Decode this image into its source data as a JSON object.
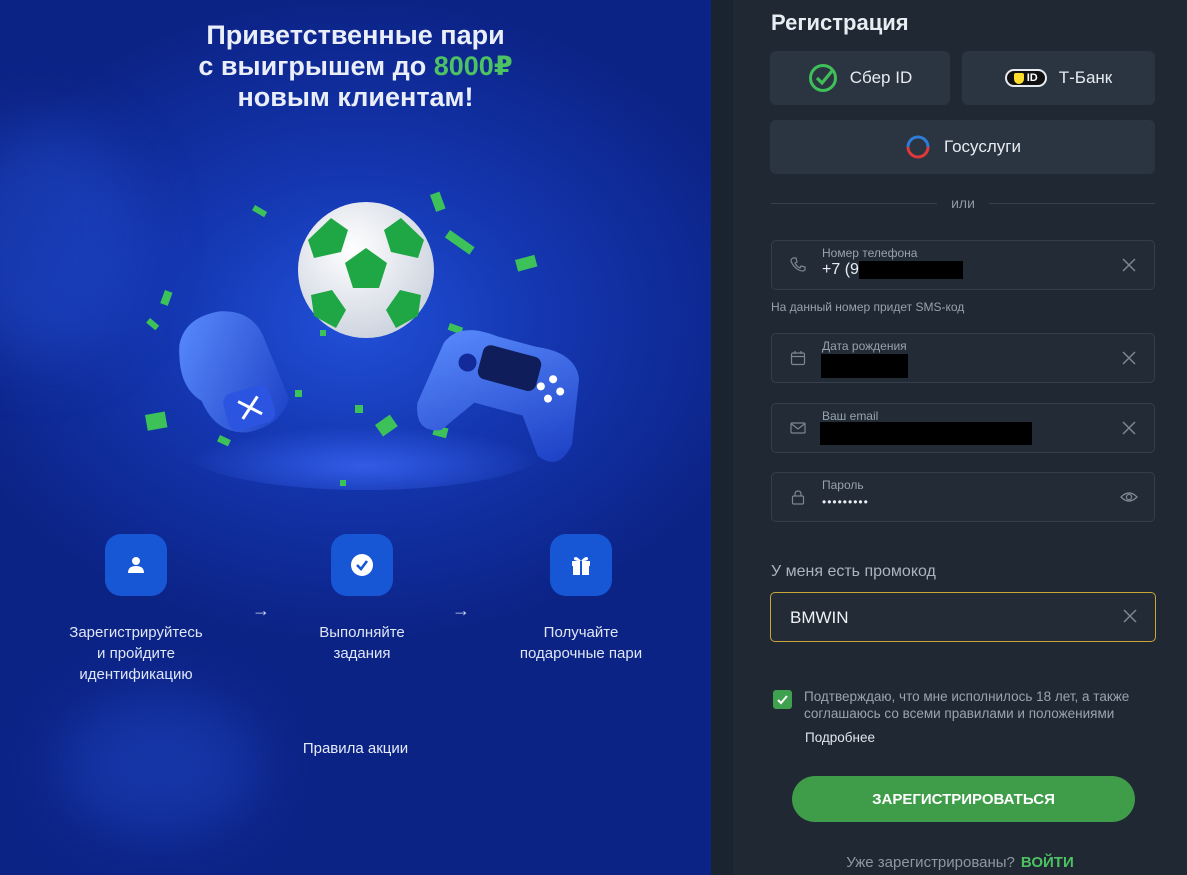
{
  "promo": {
    "headline_line1": "Приветственные пари",
    "headline_line2_prefix": "с выигрышем до",
    "headline_amount": "8000₽",
    "headline_line3": "новым клиентам!",
    "steps": [
      {
        "icon": "user-icon",
        "line1": "Зарегистрируйтесь",
        "line2": "и пройдите",
        "line3": "идентификацию"
      },
      {
        "icon": "check-circle-icon",
        "line1": "Выполняйте",
        "line2": "задания",
        "line3": ""
      },
      {
        "icon": "gift-icon",
        "line1": "Получайте",
        "line2": "подарочные пари",
        "line3": ""
      }
    ],
    "arrow": "→",
    "rules_link": "Правила акции"
  },
  "registration": {
    "title": "Регистрация",
    "sso": {
      "sber": "Сбер ID",
      "tbank": "Т-Банк",
      "tbank_badge": "ID",
      "gosuslugi": "Госуслуги"
    },
    "or_label": "или",
    "phone": {
      "label": "Номер телефона",
      "value": "+7 (9"
    },
    "phone_hint": "На данный номер придет SMS-код",
    "birthdate": {
      "label": "Дата рождения"
    },
    "email": {
      "label": "Ваш email"
    },
    "password": {
      "label": "Пароль",
      "value": "•••••••••"
    },
    "promo_label": "У меня есть промокод",
    "promo_value": "BMWIN",
    "agree_text": "Подтверждаю, что мне исполнилось 18 лет, а также соглашаюсь со всеми правилами и положениями",
    "more_link": "Подробнее",
    "submit": "ЗАРЕГИСТРИРОВАТЬСЯ",
    "already": "Уже зарегистрированы?",
    "login": "ВОЙТИ"
  },
  "colors": {
    "accent_green": "#4cc262",
    "button_green": "#3f9c49",
    "promo_blue": "#1436b0",
    "panel_bg": "#1f2833",
    "focus_border": "#c9a63a"
  }
}
